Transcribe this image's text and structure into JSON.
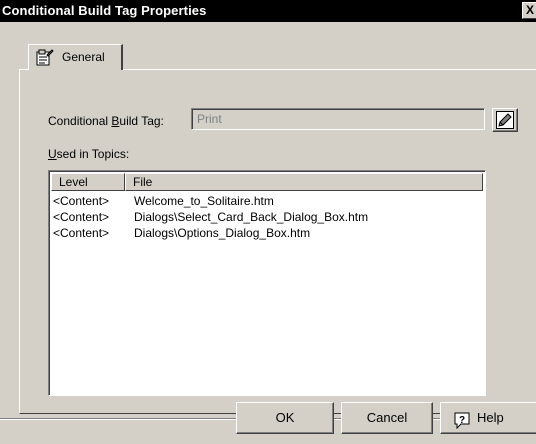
{
  "window": {
    "title": "Conditional Build Tag Properties",
    "close_glyph": "X"
  },
  "tabs": [
    {
      "label": "General",
      "icon": "properties-icon"
    }
  ],
  "tag": {
    "label_prefix": "Conditional ",
    "label_access": "B",
    "label_suffix": "uild Tag:",
    "value": "Print"
  },
  "topics": {
    "label_access": "U",
    "label_rest": "sed in Topics:",
    "columns": [
      "Level",
      "File"
    ],
    "rows": [
      {
        "level": "<Content>",
        "file": "Welcome_to_Solitaire.htm"
      },
      {
        "level": "<Content>",
        "file": "Dialogs\\Select_Card_Back_Dialog_Box.htm"
      },
      {
        "level": "<Content>",
        "file": "Dialogs\\Options_Dialog_Box.htm"
      }
    ]
  },
  "buttons": {
    "ok": "OK",
    "cancel": "Cancel",
    "help": "Help"
  },
  "icons": {
    "edit": "edit-pencil-icon",
    "help": "help-icon"
  }
}
